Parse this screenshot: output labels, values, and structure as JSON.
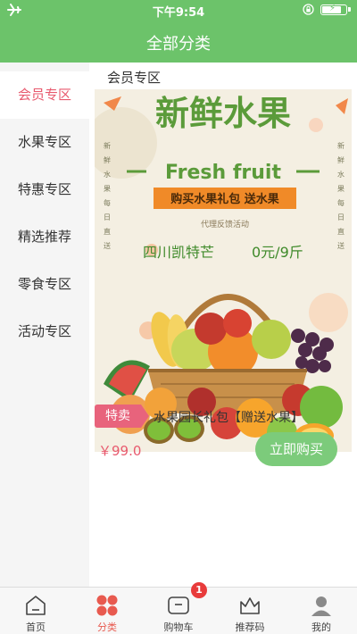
{
  "status_bar": {
    "time": "下午9:54",
    "icons": [
      "airplane-icon",
      "rotation-lock-icon",
      "battery-charging-icon"
    ]
  },
  "header": {
    "title": "全部分类"
  },
  "sidebar": {
    "items": [
      {
        "label": "会员专区",
        "active": true
      },
      {
        "label": "水果专区",
        "active": false
      },
      {
        "label": "特惠专区",
        "active": false
      },
      {
        "label": "精选推荐",
        "active": false
      },
      {
        "label": "零食专区",
        "active": false
      },
      {
        "label": "活动专区",
        "active": false
      }
    ]
  },
  "main": {
    "section_title": "会员专区",
    "poster": {
      "headline": "新鲜水果",
      "subtitle": "Fresh fruit",
      "banner": "购买水果礼包 送水果",
      "note": "代理反馈活动",
      "product": "四川凯特芒",
      "product_price": "0元/9斤",
      "side_left": [
        "新",
        "鲜",
        "水",
        "果",
        "每",
        "日",
        "直",
        "送"
      ],
      "side_right": [
        "新",
        "鲜",
        "水",
        "果",
        "每",
        "日",
        "直",
        "送"
      ]
    },
    "product": {
      "tag": "特卖",
      "name": "水果园长礼包【赠送水果】",
      "price": "￥99.0",
      "buy_label": "立即购买"
    }
  },
  "tabbar": {
    "items": [
      {
        "label": "首页",
        "icon": "home-icon",
        "active": false
      },
      {
        "label": "分类",
        "icon": "category-icon",
        "active": true
      },
      {
        "label": "购物车",
        "icon": "cart-icon",
        "active": false,
        "badge": "1"
      },
      {
        "label": "推荐码",
        "icon": "recommend-code-icon",
        "active": false
      },
      {
        "label": "我的",
        "icon": "profile-icon",
        "active": false
      }
    ]
  },
  "colors": {
    "brand_green": "#6cc36a",
    "accent_pink": "#e85a6e",
    "buy_button": "#7ccb7b",
    "badge_red": "#e83b3b"
  }
}
